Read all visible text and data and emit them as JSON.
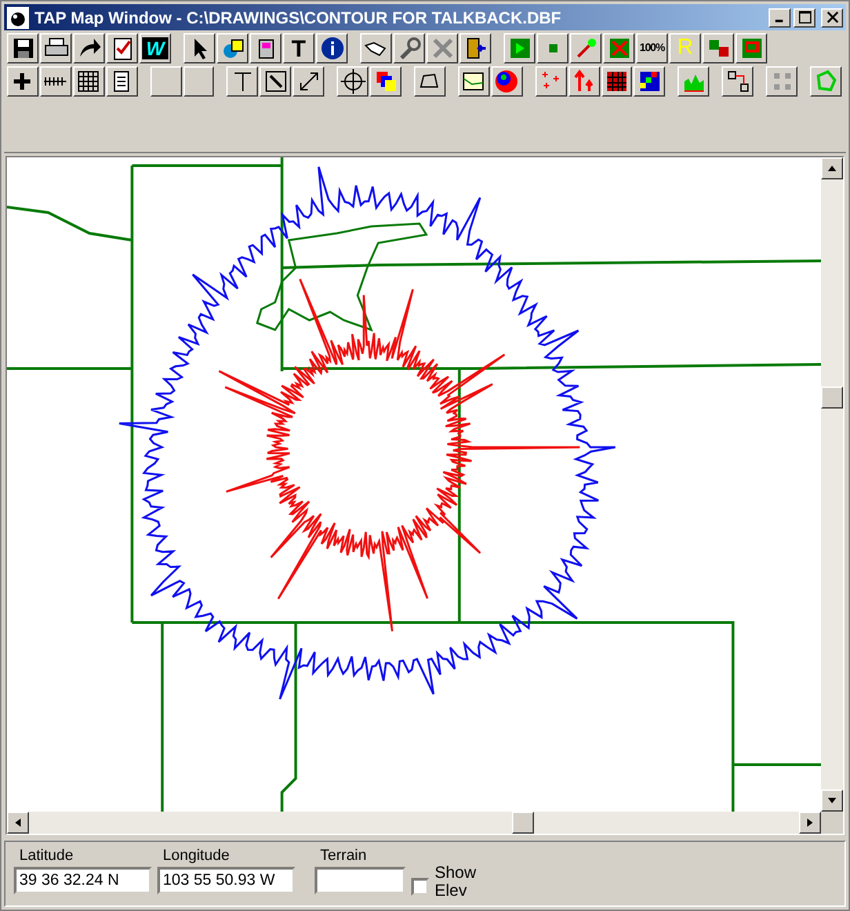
{
  "window": {
    "title": "TAP Map Window - C:\\DRAWINGS\\CONTOUR FOR TALKBACK.DBF"
  },
  "toolbar": {
    "labels": [
      "W",
      "T",
      "100%",
      "R"
    ]
  },
  "status": {
    "fields": [
      {
        "label": "Latitude",
        "value": "39 36 32.24 N"
      },
      {
        "label": "Longitude",
        "value": "103 55 50.93 W"
      },
      {
        "label": "Terrain"
      }
    ],
    "show_elev": {
      "label_1": "Show",
      "label_2": "Elev",
      "checked": false
    }
  }
}
